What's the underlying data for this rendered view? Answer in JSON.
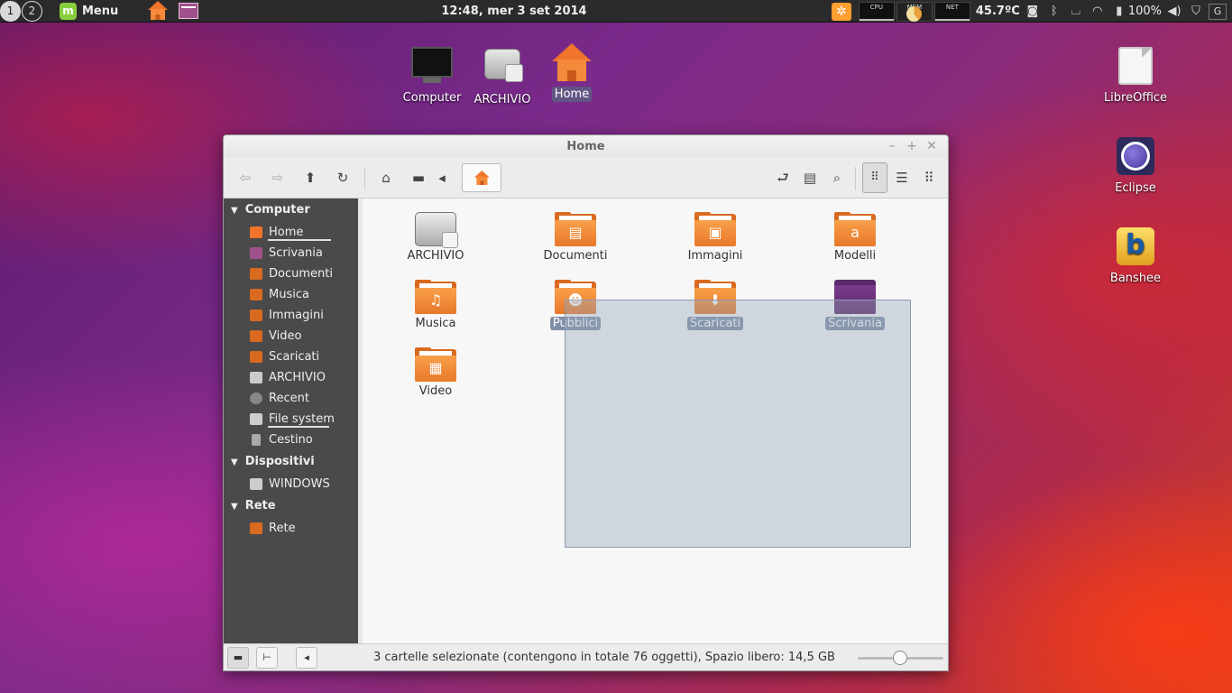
{
  "panel": {
    "workspaces": [
      "1",
      "2"
    ],
    "menu_label": "Menu",
    "clock": "12:48, mer  3 set 2014",
    "cpu_label": "CPU",
    "mem_label": "MEM",
    "net_label": "NET",
    "temperature": "45.7ºC",
    "battery": "100%"
  },
  "desktop": {
    "icons": [
      {
        "label": "Computer"
      },
      {
        "label": "ARCHIVIO"
      },
      {
        "label": "Home"
      },
      {
        "label": "LibreOffice"
      },
      {
        "label": "Eclipse"
      },
      {
        "label": "Banshee"
      }
    ]
  },
  "window": {
    "title": "Home",
    "sidebar": {
      "sections": [
        {
          "label": "Computer"
        },
        {
          "label": "Dispositivi"
        },
        {
          "label": "Rete"
        }
      ],
      "items": [
        {
          "label": "Home"
        },
        {
          "label": "Scrivania"
        },
        {
          "label": "Documenti"
        },
        {
          "label": "Musica"
        },
        {
          "label": "Immagini"
        },
        {
          "label": "Video"
        },
        {
          "label": "Scaricati"
        },
        {
          "label": "ARCHIVIO"
        },
        {
          "label": "Recent"
        },
        {
          "label": "File system"
        },
        {
          "label": "Cestino"
        },
        {
          "label": "WINDOWS"
        },
        {
          "label": "Rete"
        }
      ]
    },
    "files": [
      {
        "label": "ARCHIVIO",
        "selected": false
      },
      {
        "label": "Documenti",
        "selected": false
      },
      {
        "label": "Immagini",
        "selected": false
      },
      {
        "label": "Modelli",
        "selected": false
      },
      {
        "label": "Musica",
        "selected": false
      },
      {
        "label": "Pubblici",
        "selected": true
      },
      {
        "label": "Scaricati",
        "selected": true
      },
      {
        "label": "Scrivania",
        "selected": true
      },
      {
        "label": "Video",
        "selected": false
      }
    ],
    "status": "3 cartelle selezionate (contengono in totale 76 oggetti), Spazio libero: 14,5 GB",
    "zoom_level": 0.48
  },
  "colors": {
    "accent": "#f0742a",
    "selection": "#7f8fa6",
    "sidebar_bg": "#4a4a4a"
  }
}
